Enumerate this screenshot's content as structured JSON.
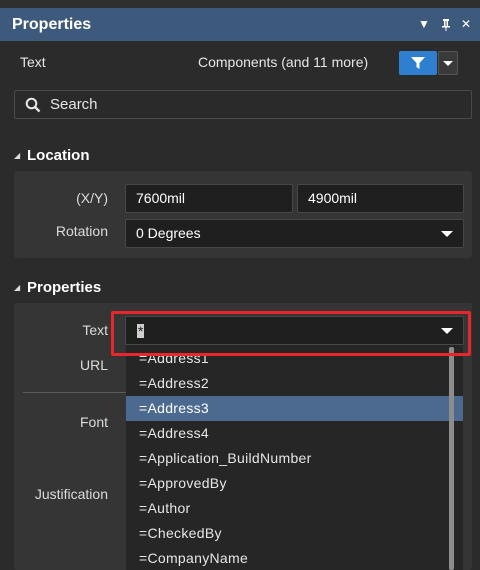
{
  "window": {
    "title": "Properties"
  },
  "header": {
    "object_type": "Text",
    "filter_scope": "Components (and 11 more)"
  },
  "search": {
    "placeholder": "Search"
  },
  "location": {
    "title": "Location",
    "xy_label": "(X/Y)",
    "x_value": "7600mil",
    "y_value": "4900mil",
    "rotation_label": "Rotation",
    "rotation_value": "0 Degrees"
  },
  "properties": {
    "title": "Properties",
    "text_label": "Text",
    "text_value": "*",
    "url_label": "URL",
    "font_label": "Font",
    "justification_label": "Justification"
  },
  "dropdown": {
    "items": [
      "=Address1",
      "=Address2",
      "=Address3",
      "=Address4",
      "=Application_BuildNumber",
      "=ApprovedBy",
      "=Author",
      "=CheckedBy",
      "=CompanyName"
    ],
    "selected_index": 2
  },
  "colors": {
    "accent": "#2f7fd0",
    "titlebar": "#3d5a7c",
    "selection": "#4c6a8f",
    "highlight_outline": "#e8262b"
  }
}
